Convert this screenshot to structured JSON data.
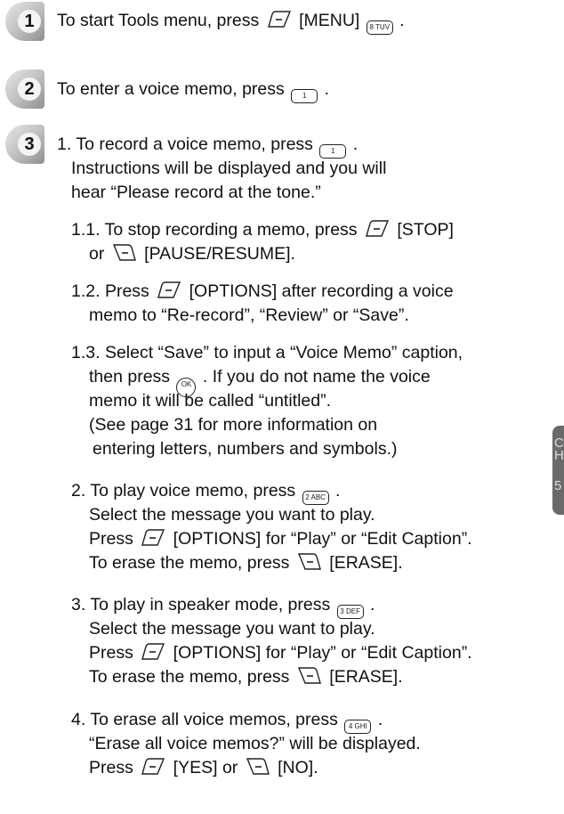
{
  "steps": [
    {
      "number": "1",
      "text_a": "To start Tools menu, press ",
      "text_b": " [MENU] ",
      "text_c": " .",
      "key_menu": "8 TUV"
    },
    {
      "number": "2",
      "text_a": "To enter a voice memo, press ",
      "text_b": " .",
      "key": "1"
    },
    {
      "number": "3"
    }
  ],
  "body": {
    "l1_a": "1. To record a voice memo, press ",
    "l1_b": " .",
    "key1": "1",
    "l2": "Instructions will be displayed and you will",
    "l3": "hear “Please record at the tone.”",
    "s11_a": "1.1. To stop recording a memo, press ",
    "s11_b": " [STOP]",
    "s11_c": "or ",
    "s11_d": " [PAUSE/RESUME].",
    "s12_a": "1.2. Press ",
    "s12_b": " [OPTIONS] after recording a voice",
    "s12_c": "memo to “Re-record”, “Review” or “Save”.",
    "s13_a": "1.3. Select “Save” to input a “Voice Memo” caption,",
    "s13_b": "then press ",
    "s13_c": " . If you do not name the voice",
    "s13_d": "memo it will be called “untitled”.",
    "s13_e": "(See page 31 for more information on",
    "s13_f": "entering letters, numbers and symbols.)",
    "ok_key": "OK",
    "p2_a": "2. To play voice memo, press ",
    "p2_b": " .",
    "key2": "2 ABC",
    "p2_c": "Select the message you want to play.",
    "p2_d": "Press ",
    "p2_e": " [OPTIONS] for “Play” or “Edit Caption”.",
    "p2_f": "To erase the memo, press ",
    "p2_g": " [ERASE].",
    "p3_a": "3. To play in speaker mode, press ",
    "p3_b": " .",
    "key3": "3 DEF",
    "p3_c": "Select the message you want to play.",
    "p3_d": "Press ",
    "p3_e": " [OPTIONS] for “Play” or “Edit Caption”.",
    "p3_f": "To erase the memo, press ",
    "p3_g": " [ERASE].",
    "p4_a": "4. To erase all voice memos, press ",
    "p4_b": " .",
    "key4": "4 GHI",
    "p4_c": "“Erase all voice memos?” will be displayed.",
    "p4_d": "Press ",
    "p4_e": " [YES] or ",
    "p4_f": " [NO]."
  },
  "side_tab": {
    "line1": "C",
    "line2": "H",
    "line3": "5"
  }
}
